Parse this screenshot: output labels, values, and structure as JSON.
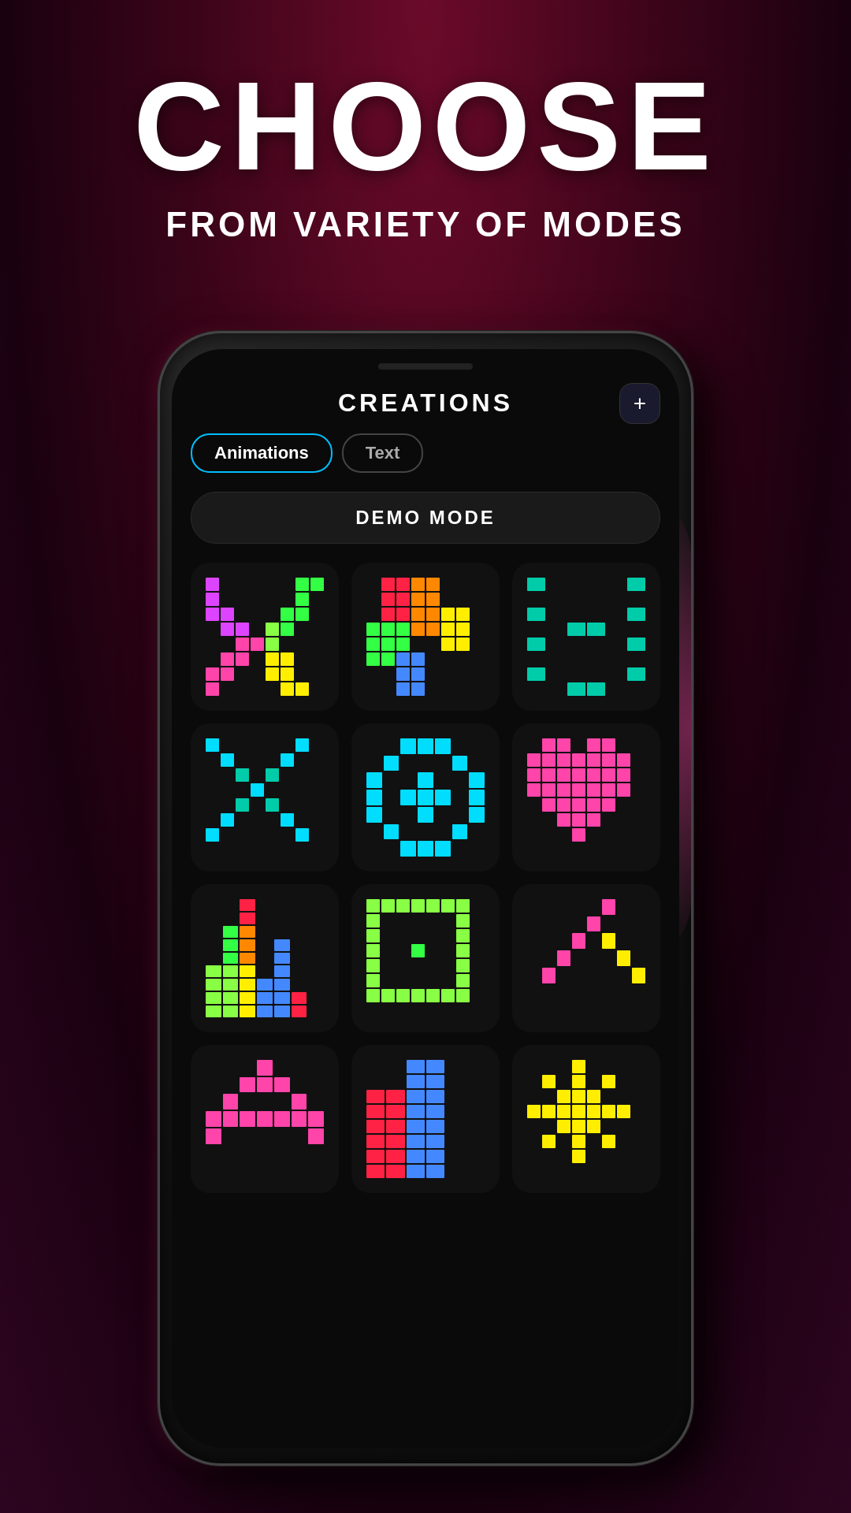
{
  "header": {
    "main_title": "CHOOSE",
    "subtitle": "FROM VARIETY OF MODES"
  },
  "screen": {
    "title": "CREATIONS",
    "add_button_label": "+",
    "tabs": [
      {
        "label": "Animations",
        "active": true
      },
      {
        "label": "Text",
        "active": false
      }
    ],
    "demo_mode_label": "DEMO MODE"
  }
}
